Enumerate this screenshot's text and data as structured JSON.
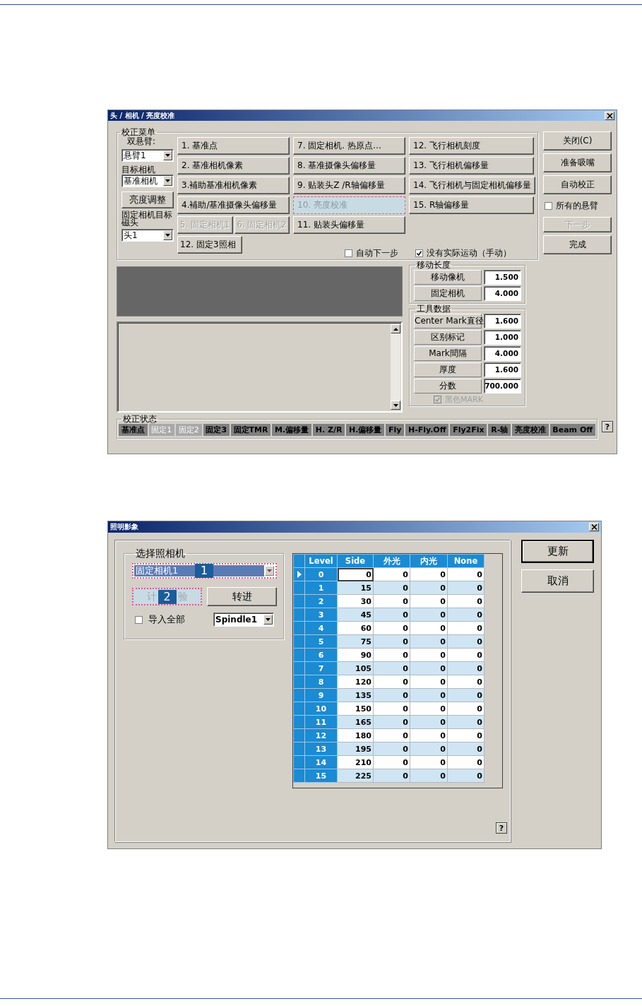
{
  "calibration_window": {
    "title": "头 / 相机 / 亮度校准",
    "menu_group": {
      "label": "校正菜单",
      "dual_arm_label": "双悬臂:",
      "arm_combo": "悬臂1",
      "target_camera_label": "目标相机",
      "target_camera_combo": "基准相机",
      "brightness_button": "亮度调整",
      "fixed_head_label": "固定相机目标磁头",
      "head_combo": "头1",
      "button_columns": [
        [
          [
            {
              "label": "1. 基准点",
              "disabled": false,
              "focused": false
            }
          ],
          [
            {
              "label": "2. 基准相机像素",
              "disabled": false,
              "focused": false
            }
          ],
          [
            {
              "label": "3.補助基准相机像素",
              "disabled": false,
              "focused": false
            }
          ],
          [
            {
              "label": "4.補助/基准摄像头偏移量",
              "disabled": false,
              "focused": false
            }
          ],
          [
            {
              "label": "5. 固定相机1",
              "disabled": true,
              "focused": false
            },
            {
              "label": "6. 固定相机2",
              "disabled": true,
              "focused": false
            }
          ],
          [
            {
              "label": "12. 固定3照相",
              "disabled": false,
              "focused": false
            }
          ]
        ],
        [
          [
            {
              "label": "7. 固定相机. 热原点…",
              "disabled": false,
              "focused": false
            }
          ],
          [
            {
              "label": "8. 基准摄像头偏移量",
              "disabled": false,
              "focused": false
            }
          ],
          [
            {
              "label": "9. 贴装头Z /R轴偏移量",
              "disabled": false,
              "focused": false
            }
          ],
          [
            {
              "label": "10. 亮度校准",
              "disabled": false,
              "focused": true
            }
          ],
          [
            {
              "label": "11. 贴装头偏移量",
              "disabled": false,
              "focused": false
            }
          ]
        ],
        [
          [
            {
              "label": "12. 飞行相机刻度",
              "disabled": false,
              "focused": false
            }
          ],
          [
            {
              "label": "13. 飞行相机偏移量",
              "disabled": false,
              "focused": false
            }
          ],
          [
            {
              "label": "14. 飞行相机与固定相机偏移量",
              "disabled": false,
              "focused": false
            }
          ],
          [
            {
              "label": "15. R轴偏移量",
              "disabled": false,
              "focused": false
            }
          ]
        ]
      ],
      "checkboxes": [
        {
          "label": "自动下一步",
          "checked": false
        },
        {
          "label": "没有实际运动（手动）",
          "checked": true
        }
      ]
    },
    "side_items": [
      {
        "kind": "button",
        "label": "关闭(C)",
        "disabled": false
      },
      {
        "kind": "button",
        "label": "准备吸嘴",
        "disabled": false
      },
      {
        "kind": "button",
        "label": "自动校正",
        "disabled": false
      },
      {
        "kind": "checkbox",
        "label": "所有的悬臂",
        "checked": false
      },
      {
        "kind": "button",
        "label": "下一步",
        "disabled": true
      },
      {
        "kind": "button",
        "label": "完成",
        "disabled": false
      }
    ],
    "move_length": {
      "label": "移动长度",
      "rows": [
        {
          "label": "移动像机",
          "value": "1.500"
        },
        {
          "label": "固定相机",
          "value": "4.000"
        }
      ]
    },
    "tool_data": {
      "label": "工具数据",
      "rows": [
        {
          "label": "Center Mark直径",
          "value": "1.600"
        },
        {
          "label": "区别标记",
          "value": "1.000"
        },
        {
          "label": "Mark間隔",
          "value": "4.000"
        },
        {
          "label": "厚度",
          "value": "1.600"
        },
        {
          "label": "分数",
          "value": "700.000"
        }
      ],
      "black_mark": {
        "label": "黑色MARK",
        "checked": true,
        "disabled": true
      }
    },
    "status": {
      "label": "校正状态",
      "items": [
        {
          "label": "基准点",
          "done": false
        },
        {
          "label": "固定1",
          "done": true
        },
        {
          "label": "固定2",
          "done": true
        },
        {
          "label": "固定3",
          "done": false
        },
        {
          "label": "固定TMR",
          "done": false
        },
        {
          "label": "M.偏移量",
          "done": false
        },
        {
          "label": "H. Z/R",
          "done": false
        },
        {
          "label": "H.偏移量",
          "done": false
        },
        {
          "label": "Fly",
          "done": false
        },
        {
          "label": "H-Fly.Off",
          "done": false
        },
        {
          "label": "Fly2Fix",
          "done": false
        },
        {
          "label": "R-轴",
          "done": false
        },
        {
          "label": "亮度校准",
          "done": false
        },
        {
          "label": "Beam Off",
          "done": false
        }
      ]
    },
    "help_button": "?"
  },
  "lighting_window": {
    "title": "照明影象",
    "camera_group": {
      "label": "选择照相机",
      "camera_combo": {
        "value": "固定相机1",
        "badge": "1",
        "focused": true
      },
      "test_button": {
        "label_start": "计",
        "badge": "2",
        "label_end": "验",
        "disabled": true,
        "focused": true
      },
      "forward_button": "转进",
      "import_all": {
        "label": "导入全部",
        "checked": false
      },
      "spindle_combo": "Spindle1"
    },
    "grid": {
      "columns": [
        "Level",
        "Side",
        "外光",
        "内光",
        "None"
      ],
      "rows": [
        {
          "cells": [
            "0",
            "0",
            "0",
            "0",
            "0"
          ],
          "selected": true
        },
        {
          "cells": [
            "1",
            "15",
            "0",
            "0",
            "0"
          ],
          "selected": false
        },
        {
          "cells": [
            "2",
            "30",
            "0",
            "0",
            "0"
          ],
          "selected": false
        },
        {
          "cells": [
            "3",
            "45",
            "0",
            "0",
            "0"
          ],
          "selected": false
        },
        {
          "cells": [
            "4",
            "60",
            "0",
            "0",
            "0"
          ],
          "selected": false
        },
        {
          "cells": [
            "5",
            "75",
            "0",
            "0",
            "0"
          ],
          "selected": false
        },
        {
          "cells": [
            "6",
            "90",
            "0",
            "0",
            "0"
          ],
          "selected": false
        },
        {
          "cells": [
            "7",
            "105",
            "0",
            "0",
            "0"
          ],
          "selected": false
        },
        {
          "cells": [
            "8",
            "120",
            "0",
            "0",
            "0"
          ],
          "selected": false
        },
        {
          "cells": [
            "9",
            "135",
            "0",
            "0",
            "0"
          ],
          "selected": false
        },
        {
          "cells": [
            "10",
            "150",
            "0",
            "0",
            "0"
          ],
          "selected": false
        },
        {
          "cells": [
            "11",
            "165",
            "0",
            "0",
            "0"
          ],
          "selected": false
        },
        {
          "cells": [
            "12",
            "180",
            "0",
            "0",
            "0"
          ],
          "selected": false
        },
        {
          "cells": [
            "13",
            "195",
            "0",
            "0",
            "0"
          ],
          "selected": false
        },
        {
          "cells": [
            "14",
            "210",
            "0",
            "0",
            "0"
          ],
          "selected": false
        },
        {
          "cells": [
            "15",
            "225",
            "0",
            "0",
            "0"
          ],
          "selected": false
        }
      ]
    },
    "buttons": [
      "更新",
      "取消"
    ],
    "help_button": "?"
  }
}
